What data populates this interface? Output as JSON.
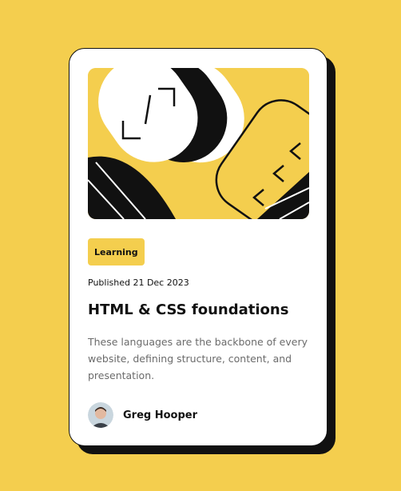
{
  "card": {
    "category": "Learning",
    "published": "Published 21 Dec 2023",
    "title": "HTML & CSS foundations",
    "description": "These languages are the backbone of every website, defining structure, content, and presentation.",
    "author_name": "Greg Hooper"
  },
  "colors": {
    "background": "#F4CE4E",
    "card": "#FFFFFF",
    "ink": "#111111",
    "muted_text": "#6B6B6B"
  },
  "icons": [
    "hero-illustration",
    "avatar"
  ]
}
